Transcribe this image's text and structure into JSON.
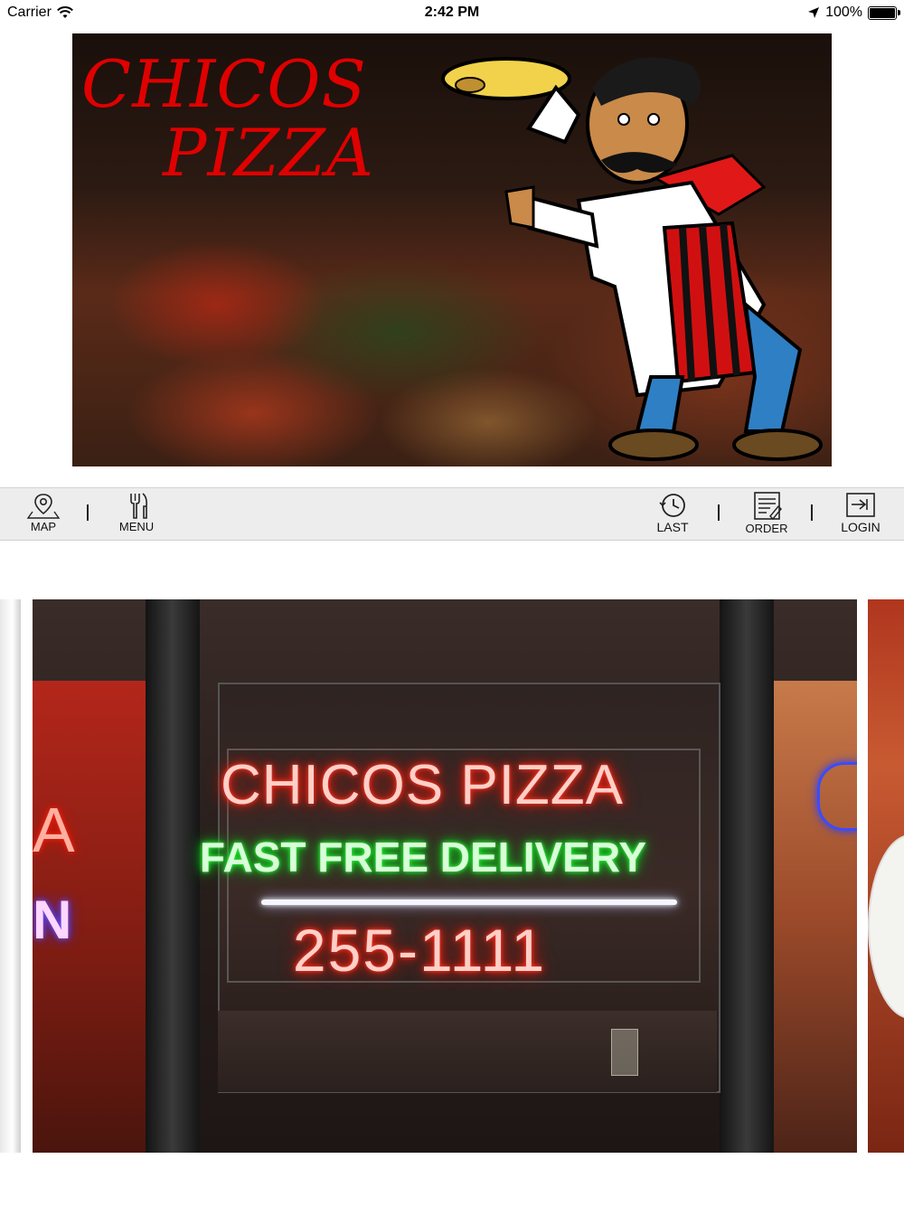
{
  "status_bar": {
    "carrier": "Carrier",
    "time": "2:42 PM",
    "battery": "100%",
    "battery_level": 1.0
  },
  "banner": {
    "brand_line1": "CHICOS",
    "brand_line2": "PIZZA"
  },
  "toolbar": {
    "map_label": "MAP",
    "menu_label": "MENU",
    "last_label": "LAST",
    "order_label": "ORDER",
    "login_label": "LOGIN",
    "separator": "|"
  },
  "carousel": {
    "current_slide": {
      "sign_line1": "CHICOS PIZZA",
      "sign_line2": "FAST FREE DELIVERY",
      "sign_line3": "255-1111"
    },
    "left_slide_fragment": "A",
    "left_slide_fragment2": "N"
  },
  "colors": {
    "brand_red": "#e00000",
    "toolbar_bg": "#ededed",
    "neon_red": "#ff2010",
    "neon_green": "#12d820"
  }
}
